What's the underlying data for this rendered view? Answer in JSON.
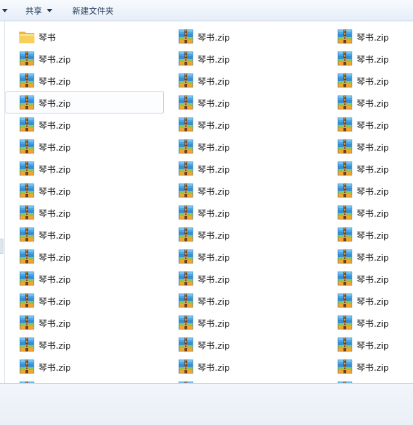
{
  "toolbar": {
    "share_label": "共享",
    "new_folder_label": "新建文件夹"
  },
  "colors": {
    "toolbar_text": "#1e395b",
    "selection_border": "#bcd4ef",
    "folder": "#f3c64f",
    "archive_blue": "#3a9ad9",
    "archive_green": "#7cc24a",
    "archive_orange": "#f5a623"
  },
  "files": [
    {
      "name": "琴书",
      "type": "folder"
    },
    {
      "name": "琴书.zip",
      "type": "zip"
    },
    {
      "name": "琴书.zip",
      "type": "zip"
    },
    {
      "name": "琴书.zip",
      "type": "zip"
    },
    {
      "name": "琴书.zip",
      "type": "zip"
    },
    {
      "name": "琴书.zip",
      "type": "zip"
    },
    {
      "name": "琴书.zip",
      "type": "zip"
    },
    {
      "name": "琴书.zip",
      "type": "zip"
    },
    {
      "name": "琴书.zip",
      "type": "zip"
    },
    {
      "name": "琴书.zip",
      "type": "zip",
      "selected": true
    },
    {
      "name": "琴书.zip",
      "type": "zip"
    },
    {
      "name": "琴书.zip",
      "type": "zip"
    },
    {
      "name": "琴书.zip",
      "type": "zip"
    },
    {
      "name": "琴书.zip",
      "type": "zip"
    },
    {
      "name": "琴书.zip",
      "type": "zip"
    },
    {
      "name": "琴书.zip",
      "type": "zip"
    },
    {
      "name": "琴书.zip",
      "type": "zip"
    },
    {
      "name": "琴书.zip",
      "type": "zip"
    },
    {
      "name": "琴书.zip",
      "type": "zip"
    },
    {
      "name": "琴书.zip",
      "type": "zip"
    },
    {
      "name": "琴书.zip",
      "type": "zip"
    },
    {
      "name": "琴书.zip",
      "type": "zip"
    },
    {
      "name": "琴书.zip",
      "type": "zip"
    },
    {
      "name": "琴书.zip",
      "type": "zip"
    },
    {
      "name": "琴书.zip",
      "type": "zip"
    },
    {
      "name": "琴书.zip",
      "type": "zip"
    },
    {
      "name": "琴书.zip",
      "type": "zip"
    },
    {
      "name": "琴书.zip",
      "type": "zip"
    },
    {
      "name": "琴书.zip",
      "type": "zip"
    },
    {
      "name": "琴书.zip",
      "type": "zip"
    },
    {
      "name": "琴书.zip",
      "type": "zip"
    },
    {
      "name": "琴书.zip",
      "type": "zip"
    },
    {
      "name": "琴书.zip",
      "type": "zip"
    },
    {
      "name": "琴书.zip",
      "type": "zip"
    },
    {
      "name": "琴书.zip",
      "type": "zip"
    },
    {
      "name": "琴书.zip",
      "type": "zip"
    },
    {
      "name": "琴书.zip",
      "type": "zip"
    },
    {
      "name": "琴书.zip",
      "type": "zip"
    },
    {
      "name": "琴书.zip",
      "type": "zip"
    },
    {
      "name": "琴书.zip",
      "type": "zip"
    },
    {
      "name": "琴书.zip",
      "type": "zip"
    },
    {
      "name": "琴书.zip",
      "type": "zip"
    },
    {
      "name": "琴书.zip",
      "type": "zip"
    },
    {
      "name": "琴书.zip",
      "type": "zip"
    },
    {
      "name": "琴书.zip",
      "type": "zip"
    },
    {
      "name": "琴书.zip",
      "type": "zip"
    },
    {
      "name": "琴书.zip",
      "type": "zip"
    },
    {
      "name": "琴书.zip",
      "type": "zip"
    },
    {
      "name": "",
      "type": "zip"
    },
    {
      "name": "",
      "type": "zip"
    },
    {
      "name": "",
      "type": "zip"
    }
  ]
}
